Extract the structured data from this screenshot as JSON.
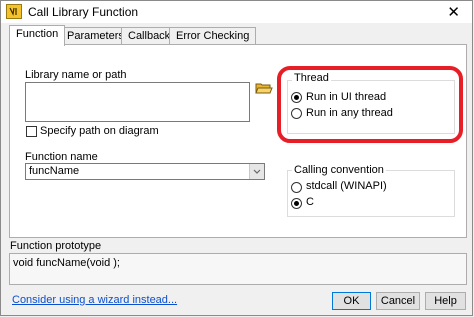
{
  "window": {
    "title": "Call Library Function"
  },
  "tabs": [
    {
      "label": "Function",
      "active": true
    },
    {
      "label": "Parameters",
      "active": false
    },
    {
      "label": "Callbacks",
      "active": false
    },
    {
      "label": "Error Checking",
      "active": false
    }
  ],
  "library": {
    "label": "Library name or path",
    "value": "",
    "browse_icon": "folder-open-icon",
    "specify_path_label": "Specify path on diagram",
    "specify_path_checked": false
  },
  "function_name": {
    "label": "Function name",
    "value": "funcName"
  },
  "thread": {
    "label": "Thread",
    "options": [
      {
        "label": "Run in UI thread",
        "checked": true
      },
      {
        "label": "Run in any thread",
        "checked": false
      }
    ]
  },
  "calling_convention": {
    "label": "Calling convention",
    "options": [
      {
        "label": "stdcall (WINAPI)",
        "checked": false
      },
      {
        "label": "C",
        "checked": true
      }
    ]
  },
  "prototype": {
    "label": "Function prototype",
    "value": "void  funcName(void );"
  },
  "footer": {
    "wizard_link": "Consider using a wizard instead...",
    "ok_label": "OK",
    "cancel_label": "Cancel",
    "help_label": "Help"
  },
  "colors": {
    "highlight": "#e81e26",
    "link": "#0b4fcf"
  }
}
